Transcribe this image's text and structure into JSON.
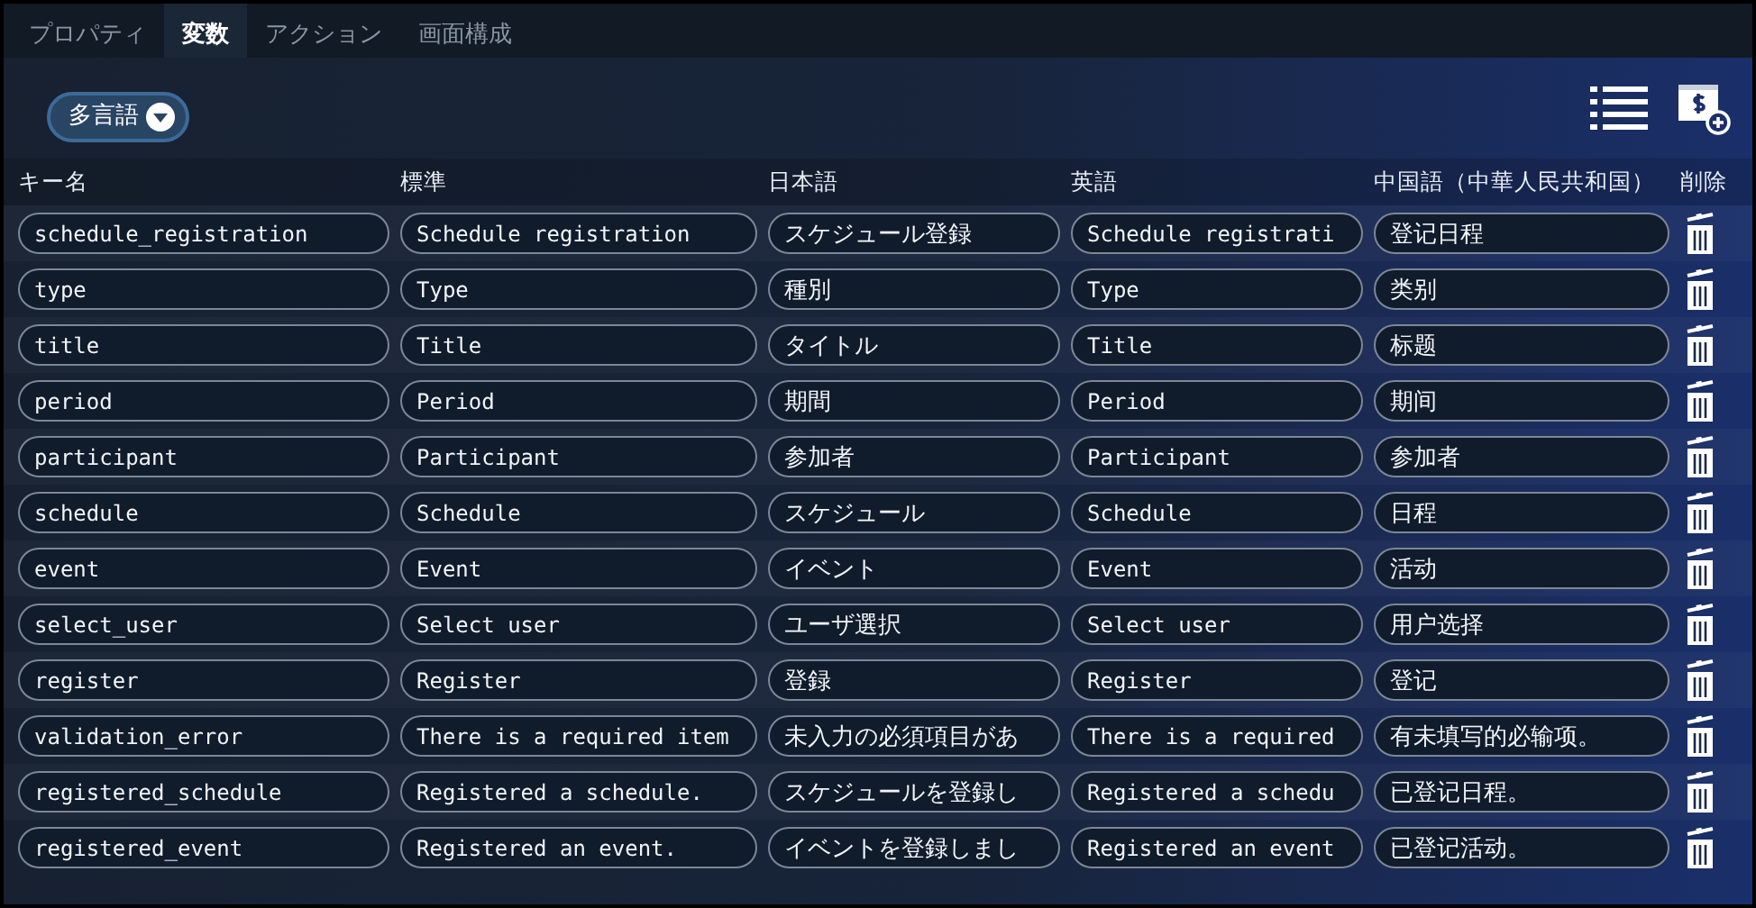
{
  "tabs": [
    {
      "label": "プロパティ",
      "selected": false
    },
    {
      "label": "変数",
      "selected": true
    },
    {
      "label": "アクション",
      "selected": false
    },
    {
      "label": "画面構成",
      "selected": false
    }
  ],
  "language_button": {
    "label": "多言語"
  },
  "table": {
    "columns": [
      "キー名",
      "標準",
      "日本語",
      "英語",
      "中国語（中華人民共和国）",
      "削除"
    ],
    "rows": [
      {
        "key": "schedule_registration",
        "standard": "Schedule registration",
        "japanese": "スケジュール登録",
        "english": "Schedule registrati",
        "chinese": "登记日程"
      },
      {
        "key": "type",
        "standard": "Type",
        "japanese": "種別",
        "english": "Type",
        "chinese": "类别"
      },
      {
        "key": "title",
        "standard": "Title",
        "japanese": "タイトル",
        "english": "Title",
        "chinese": "标题"
      },
      {
        "key": "period",
        "standard": "Period",
        "japanese": "期間",
        "english": "Period",
        "chinese": "期间"
      },
      {
        "key": "participant",
        "standard": "Participant",
        "japanese": "参加者",
        "english": "Participant",
        "chinese": "参加者"
      },
      {
        "key": "schedule",
        "standard": "Schedule",
        "japanese": "スケジュール",
        "english": "Schedule",
        "chinese": "日程"
      },
      {
        "key": "event",
        "standard": "Event",
        "japanese": "イベント",
        "english": "Event",
        "chinese": "活动"
      },
      {
        "key": "select_user",
        "standard": "Select user",
        "japanese": "ユーザ選択",
        "english": "Select user",
        "chinese": "用户选择"
      },
      {
        "key": "register",
        "standard": "Register",
        "japanese": "登録",
        "english": "Register",
        "chinese": "登记"
      },
      {
        "key": "validation_error",
        "standard": "There is a required item",
        "japanese": "未入力の必須項目があ",
        "english": "There is a required",
        "chinese": "有未填写的必输项。"
      },
      {
        "key": "registered_schedule",
        "standard": "Registered a schedule.",
        "japanese": "スケジュールを登録し",
        "english": "Registered a schedu",
        "chinese": "已登记日程。"
      },
      {
        "key": "registered_event",
        "standard": "Registered an event.",
        "japanese": "イベントを登録しまし",
        "english": "Registered an event",
        "chinese": "已登记活动。"
      }
    ]
  }
}
